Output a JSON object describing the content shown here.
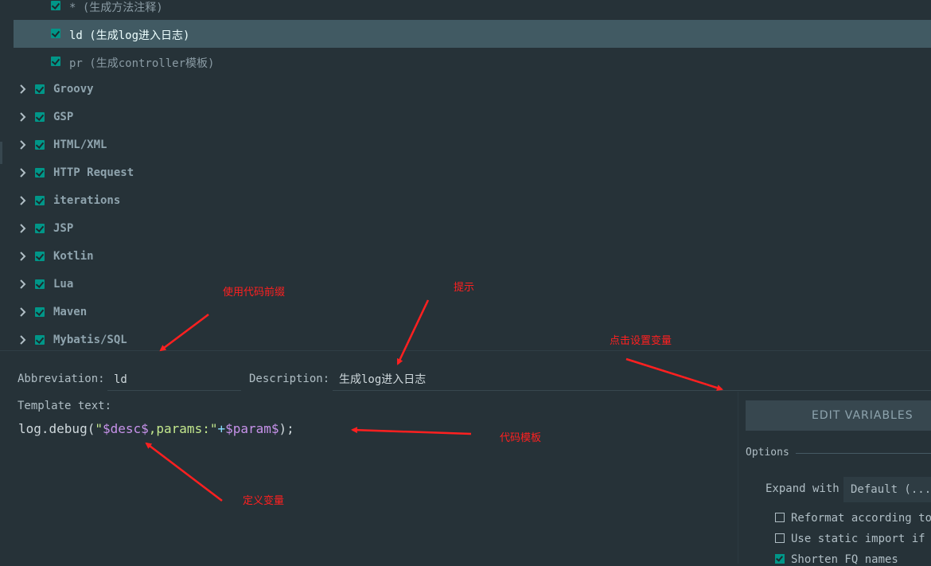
{
  "tree": {
    "children": [
      {
        "label": "* (生成方法注释)",
        "selected": false
      },
      {
        "label": "ld (生成log进入日志)",
        "selected": true
      },
      {
        "label": "pr (生成controller模板)",
        "selected": false
      }
    ],
    "groups": [
      "Groovy",
      "GSP",
      "HTML/XML",
      "HTTP Request",
      "iterations",
      "JSP",
      "Kotlin",
      "Lua",
      "Maven",
      "Mybatis/SQL"
    ]
  },
  "form": {
    "abbreviation_label": "Abbreviation:",
    "abbreviation_value": "ld",
    "description_label": "Description:",
    "description_value": "生成log进入日志",
    "template_label": "Template text:"
  },
  "template": {
    "p1": "log.debug(",
    "p2": "\"",
    "p3": "$desc$",
    "p4": ",params:\"",
    "p5": "+",
    "p6": "$param$",
    "p7": ");"
  },
  "panel": {
    "edit_variables": "EDIT VARIABLES",
    "options_label": "Options",
    "expand_label": "Expand with",
    "expand_value": "Default (...",
    "opt_reformat": "Reformat according to",
    "opt_static": "Use static import if p",
    "opt_shorten": "Shorten FQ names"
  },
  "annotations": {
    "prefix": "使用代码前缀",
    "hint": "提示",
    "vars_click": "点击设置变量",
    "code_tpl": "代码模板",
    "define_var": "定义变量"
  },
  "colors": {
    "accent": "#009688",
    "annotation": "#ff2020",
    "selected_row": "#415a63"
  }
}
